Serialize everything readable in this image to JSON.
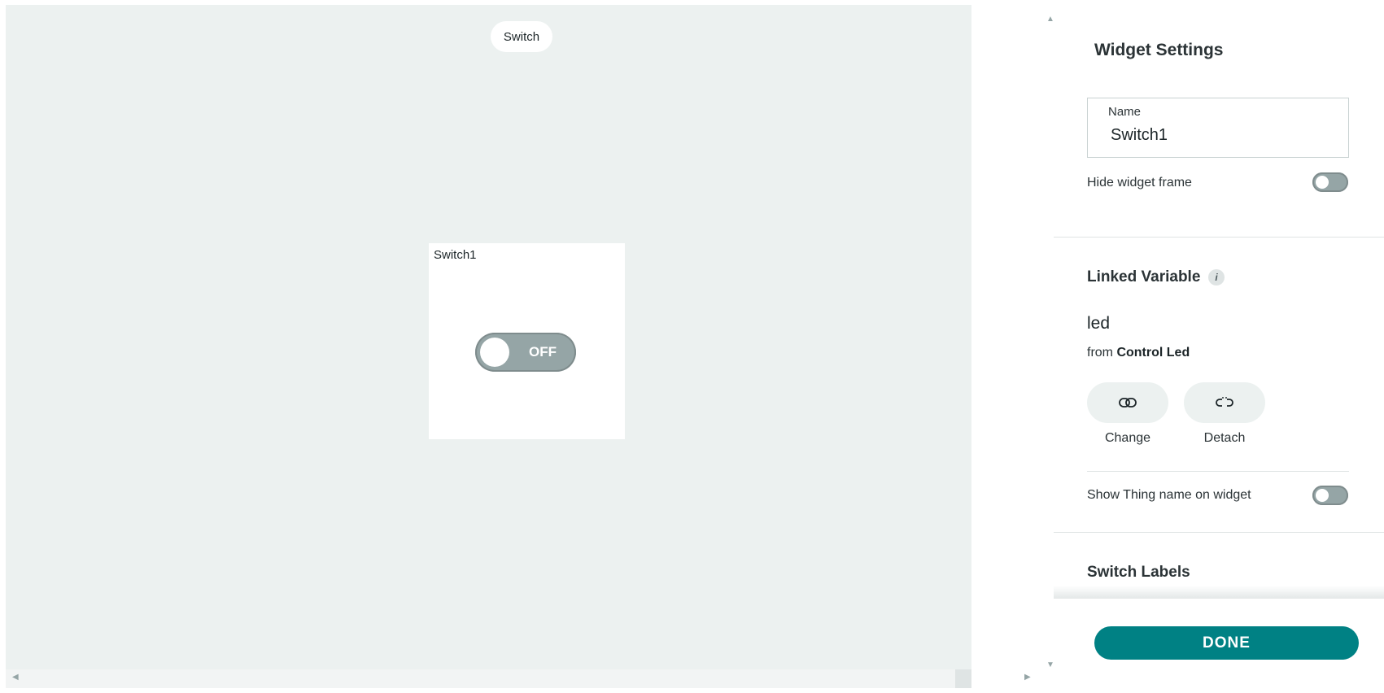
{
  "canvas": {
    "title_pill": "Switch",
    "widget": {
      "name": "Switch1",
      "toggle_state": "OFF"
    }
  },
  "panel": {
    "title": "Widget Settings",
    "name_field": {
      "label": "Name",
      "value": "Switch1"
    },
    "hide_frame": {
      "label": "Hide widget frame",
      "enabled": false
    },
    "linked_variable": {
      "section_title": "Linked Variable",
      "info_icon": "i",
      "variable_name": "led",
      "from_prefix": "from",
      "from_thing": "Control Led",
      "change_label": "Change",
      "detach_label": "Detach",
      "change_icon": "link-icon",
      "detach_icon": "unlink-icon"
    },
    "show_thing_name": {
      "label": "Show Thing name on widget",
      "enabled": false
    },
    "switch_labels_title": "Switch Labels",
    "done_label": "DONE"
  },
  "colors": {
    "canvas_bg": "#ecf1f0",
    "accent": "#008184",
    "toggle_off": "#95a5a6"
  }
}
